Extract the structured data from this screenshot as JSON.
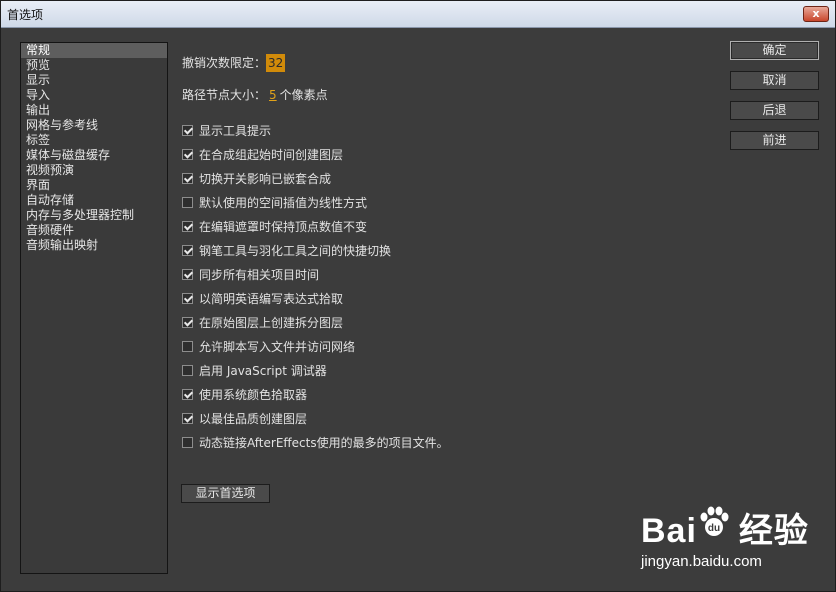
{
  "window": {
    "title": "首选项",
    "close_glyph": "x"
  },
  "sidebar": {
    "items": [
      {
        "label": "常规",
        "selected": true
      },
      {
        "label": "预览"
      },
      {
        "label": "显示"
      },
      {
        "label": "导入"
      },
      {
        "label": "输出"
      },
      {
        "label": "网格与参考线"
      },
      {
        "label": "标签"
      },
      {
        "label": "媒体与磁盘缓存"
      },
      {
        "label": "视频预演"
      },
      {
        "label": "界面"
      },
      {
        "label": "自动存储"
      },
      {
        "label": "内存与多处理器控制"
      },
      {
        "label": "音频硬件"
      },
      {
        "label": "音频输出映射"
      }
    ]
  },
  "main": {
    "undo": {
      "label": "撤销次数限定：",
      "value": "32"
    },
    "path_point": {
      "label": "路径节点大小：",
      "value": "5",
      "unit": "个像素点"
    },
    "checkboxes": [
      {
        "label": "显示工具提示",
        "checked": true
      },
      {
        "label": "在合成组起始时间创建图层",
        "checked": true
      },
      {
        "label": "切换开关影响已嵌套合成",
        "checked": true
      },
      {
        "label": "默认使用的空间插值为线性方式",
        "checked": false
      },
      {
        "label": "在编辑遮罩时保持顶点数值不变",
        "checked": true
      },
      {
        "label": "钢笔工具与羽化工具之间的快捷切换",
        "checked": true
      },
      {
        "label": "同步所有相关项目时间",
        "checked": true
      },
      {
        "label": "以简明英语编写表达式拾取",
        "checked": true
      },
      {
        "label": "在原始图层上创建拆分图层",
        "checked": true
      },
      {
        "label": "允许脚本写入文件并访问网络",
        "checked": false
      },
      {
        "label": "启用 JavaScript 调试器",
        "checked": false
      },
      {
        "label": "使用系统颜色拾取器",
        "checked": true
      },
      {
        "label": "以最佳品质创建图层",
        "checked": true
      },
      {
        "label": "动态链接AfterEffects使用的最多的项目文件。",
        "checked": false
      }
    ],
    "reveal_button": "显示首选项"
  },
  "buttons": {
    "ok": "确定",
    "cancel": "取消",
    "previous": "后退",
    "next": "前进"
  },
  "watermark": {
    "brand_left": "Bai",
    "brand_right": "经验",
    "url": "jingyan.baidu.com"
  },
  "colors": {
    "accent": "#d18b0a",
    "background": "#3c3c3c"
  }
}
